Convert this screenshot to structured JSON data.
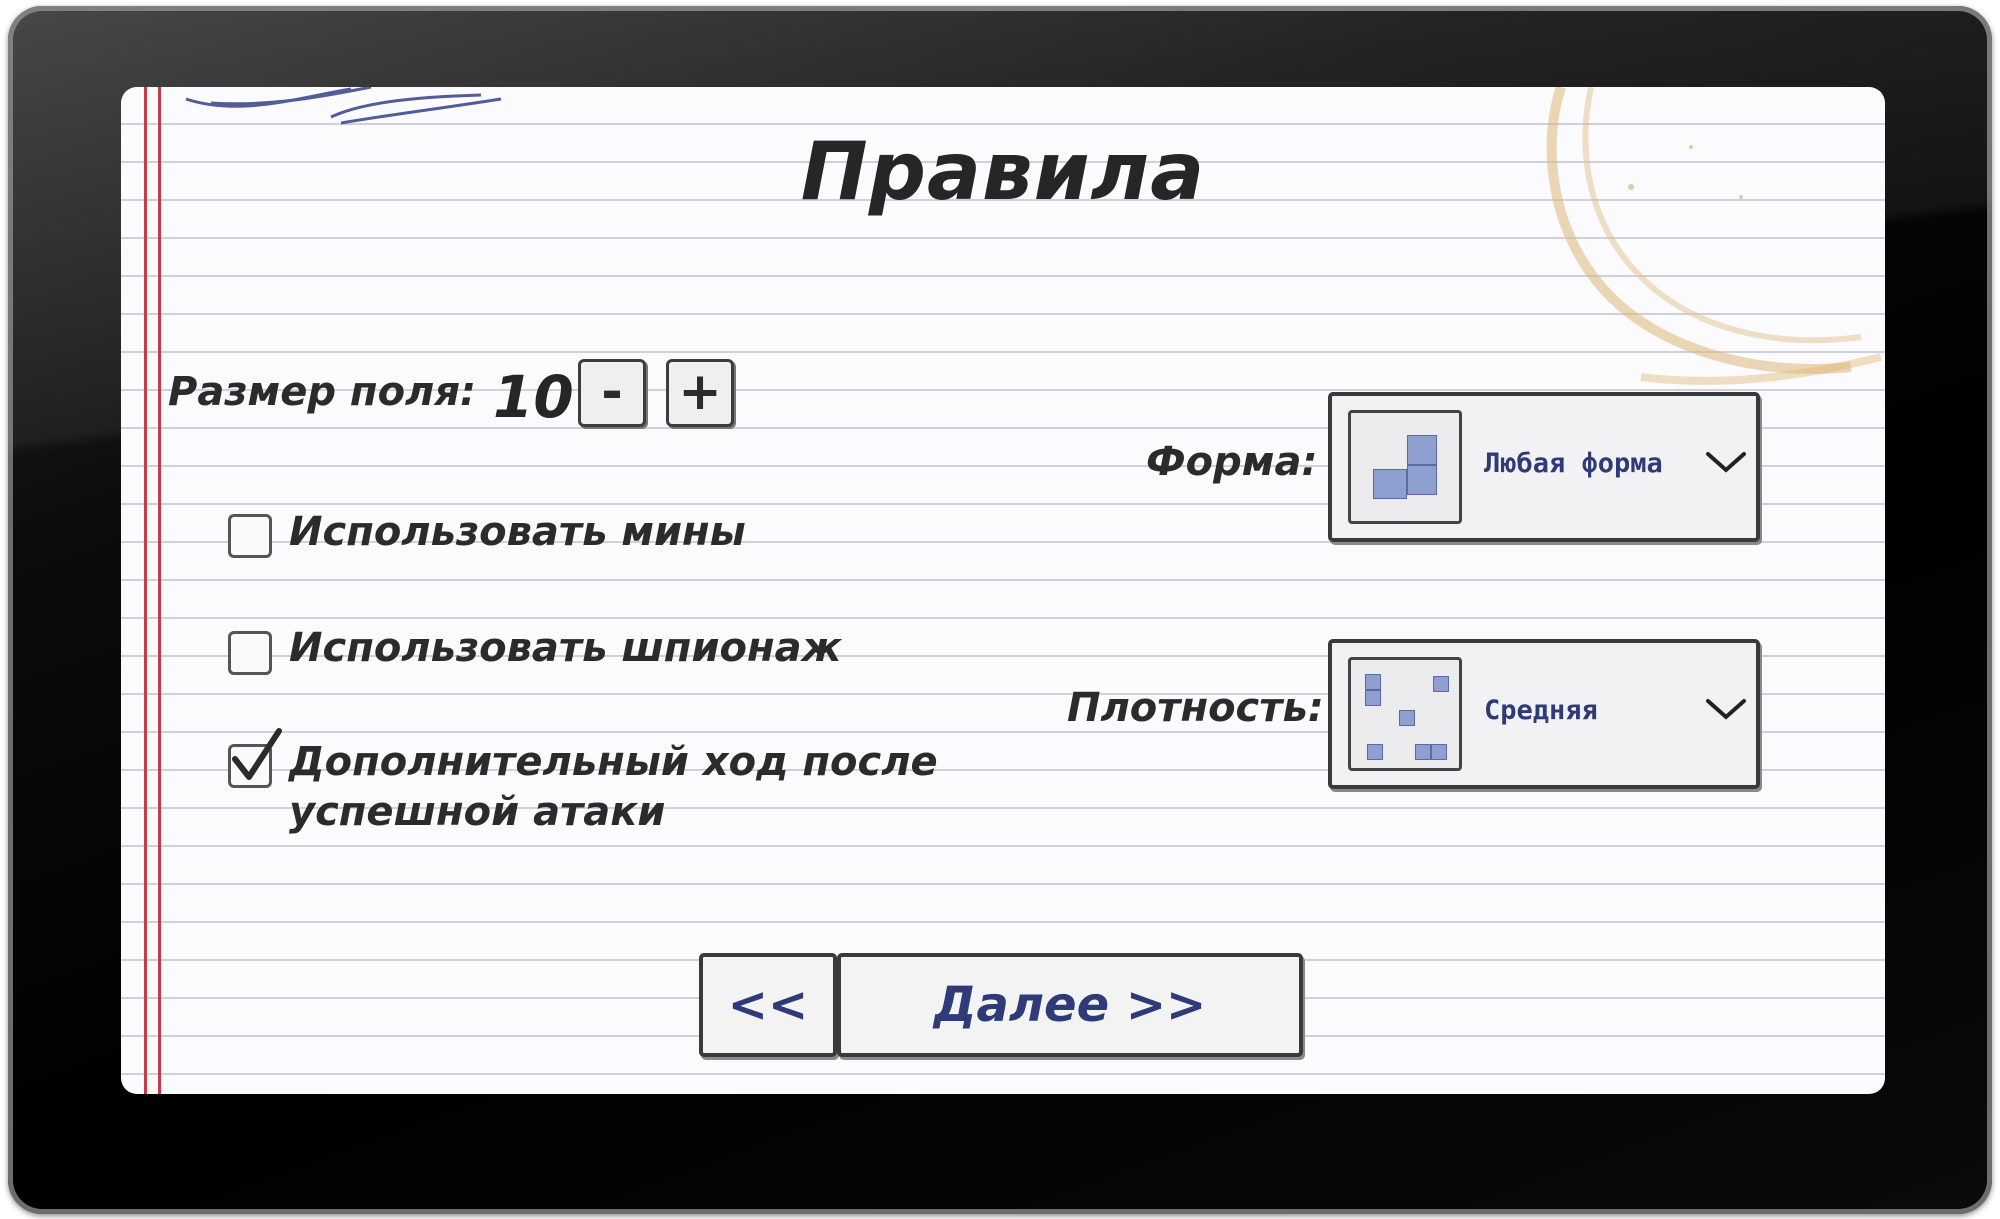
{
  "title": "Правила",
  "field_size": {
    "label": "Размер поля:",
    "value": "10",
    "decrement_label": "-",
    "increment_label": "+"
  },
  "options": [
    {
      "label": "Использовать мины",
      "checked": false
    },
    {
      "label": "Использовать шпионаж",
      "checked": false
    },
    {
      "label_line1": "Дополнительный ход после",
      "label_line2": "успешной атаки",
      "checked": true
    }
  ],
  "shape": {
    "label": "Форма:",
    "value": "Любая форма",
    "icon": "polyomino-shape-icon"
  },
  "density": {
    "label": "Плотность:",
    "value": "Средняя",
    "icon": "scattered-cells-icon"
  },
  "buttons": {
    "back_label": "<<",
    "next_label": "Далее >>"
  },
  "colors": {
    "margin_line": "#c43b4a",
    "ink_blue": "#2f3a78",
    "ruled_line": "#cfd0dc"
  }
}
